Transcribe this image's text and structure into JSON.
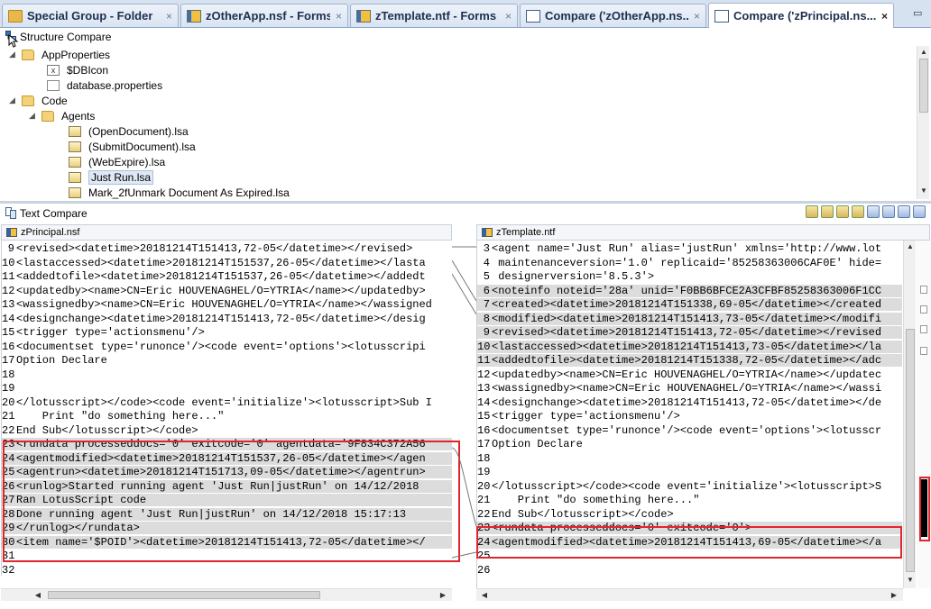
{
  "tabs": [
    {
      "label": "Special Group - Folder",
      "icon": "folder-icon",
      "active": false
    },
    {
      "label": "zOtherApp.nsf - Forms",
      "icon": "database-icon",
      "active": false
    },
    {
      "label": "zTemplate.ntf - Forms",
      "icon": "database-icon",
      "active": false
    },
    {
      "label": "Compare ('zOtherApp.ns...",
      "icon": "compare-icon",
      "active": false
    },
    {
      "label": "Compare ('zPrincipal.ns...",
      "icon": "compare-icon",
      "active": true
    }
  ],
  "close_glyph": "×",
  "structure_compare": {
    "title": "Structure Compare",
    "tree": [
      {
        "label": "AppProperties",
        "type": "folder",
        "expanded": true
      },
      {
        "label": "$DBIcon",
        "type": "resource"
      },
      {
        "label": "database.properties",
        "type": "document"
      },
      {
        "label": "Code",
        "type": "folder",
        "expanded": true
      },
      {
        "label": "Agents",
        "type": "folder",
        "expanded": true
      },
      {
        "label": "(OpenDocument).lsa",
        "type": "agent"
      },
      {
        "label": "(SubmitDocument).lsa",
        "type": "agent"
      },
      {
        "label": "(WebExpire).lsa",
        "type": "agent"
      },
      {
        "label": "Just Run.lsa",
        "type": "agent",
        "selected": true
      },
      {
        "label": "Mark_2fUnmark Document As Expired.lsa",
        "type": "agent"
      }
    ]
  },
  "text_compare": {
    "title": "Text Compare",
    "left": {
      "file": "zPrincipal.nsf",
      "lines": [
        {
          "n": "9",
          "t": "<revised><datetime>20181214T151413,72-05</datetime></revised>"
        },
        {
          "n": "10",
          "t": "<lastaccessed><datetime>20181214T151537,26-05</datetime></lasta"
        },
        {
          "n": "11",
          "t": "<addedtofile><datetime>20181214T151537,26-05</datetime></addedt"
        },
        {
          "n": "12",
          "t": "<updatedby><name>CN=Eric HOUVENAGHEL/O=YTRIA</name></updatedby>"
        },
        {
          "n": "13",
          "t": "<wassignedby><name>CN=Eric HOUVENAGHEL/O=YTRIA</name></wassigned"
        },
        {
          "n": "14",
          "t": "<designchange><datetime>20181214T151413,72-05</datetime></desig"
        },
        {
          "n": "15",
          "t": "<trigger type='actionsmenu'/>"
        },
        {
          "n": "16",
          "t": "<documentset type='runonce'/><code event='options'><lotusscripi"
        },
        {
          "n": "17",
          "t": "Option Declare"
        },
        {
          "n": "18",
          "t": ""
        },
        {
          "n": "19",
          "t": ""
        },
        {
          "n": "20",
          "t": "</lotusscript></code><code event='initialize'><lotusscript>Sub I"
        },
        {
          "n": "21",
          "t": "    Print \"do something here...\""
        },
        {
          "n": "22",
          "t": "End Sub</lotusscript></code>"
        },
        {
          "n": "23",
          "t": "<rundata processeddocs='0' exitcode='0' agentdata='9F834C372A56"
        },
        {
          "n": "24",
          "t": "<agentmodified><datetime>20181214T151537,26-05</datetime></agen"
        },
        {
          "n": "25",
          "t": "<agentrun><datetime>20181214T151713,09-05</datetime></agentrun>"
        },
        {
          "n": "26",
          "t": "<runlog>Started running agent 'Just Run|justRun' on 14/12/2018 "
        },
        {
          "n": "27",
          "t": "Ran LotusScript code"
        },
        {
          "n": "28",
          "t": "Done running agent 'Just Run|justRun' on 14/12/2018 15:17:13"
        },
        {
          "n": "29",
          "t": "</runlog></rundata>"
        },
        {
          "n": "30",
          "t": "<item name='$POID'><datetime>20181214T151413,72-05</datetime></"
        },
        {
          "n": "31",
          "t": ""
        },
        {
          "n": "32",
          "t": ""
        }
      ]
    },
    "right": {
      "file": "zTemplate.ntf",
      "lines": [
        {
          "n": "3",
          "t": "<agent name='Just Run' alias='justRun' xmlns='http://www.lot"
        },
        {
          "n": "4",
          "t": " maintenanceversion='1.0' replicaid='85258363006CAF0E' hide="
        },
        {
          "n": "5",
          "t": " designerversion='8.5.3'>"
        },
        {
          "n": "6",
          "t": "<noteinfo noteid='28a' unid='F0BB6BFCE2A3CFBF85258363006F1CC"
        },
        {
          "n": "7",
          "t": "<created><datetime>20181214T151338,69-05</datetime></created"
        },
        {
          "n": "8",
          "t": "<modified><datetime>20181214T151413,73-05</datetime></modifi"
        },
        {
          "n": "9",
          "t": "<revised><datetime>20181214T151413,72-05</datetime></revised"
        },
        {
          "n": "10",
          "t": "<lastaccessed><datetime>20181214T151413,73-05</datetime></la"
        },
        {
          "n": "11",
          "t": "<addedtofile><datetime>20181214T151338,72-05</datetime></adc"
        },
        {
          "n": "12",
          "t": "<updatedby><name>CN=Eric HOUVENAGHEL/O=YTRIA</name></updatec"
        },
        {
          "n": "13",
          "t": "<wassignedby><name>CN=Eric HOUVENAGHEL/O=YTRIA</name></wassi"
        },
        {
          "n": "14",
          "t": "<designchange><datetime>20181214T151413,72-05</datetime></de"
        },
        {
          "n": "15",
          "t": "<trigger type='actionsmenu'/>"
        },
        {
          "n": "16",
          "t": "<documentset type='runonce'/><code event='options'><lotusscr"
        },
        {
          "n": "17",
          "t": "Option Declare"
        },
        {
          "n": "18",
          "t": ""
        },
        {
          "n": "19",
          "t": ""
        },
        {
          "n": "20",
          "t": "</lotusscript></code><code event='initialize'><lotusscript>S"
        },
        {
          "n": "21",
          "t": "    Print \"do something here...\""
        },
        {
          "n": "22",
          "t": "End Sub</lotusscript></code>"
        },
        {
          "n": "23",
          "t": "<rundata processeddocs='0' exitcode='0'>"
        },
        {
          "n": "24",
          "t": "<agentmodified><datetime>20181214T151413,69-05</datetime></a"
        },
        {
          "n": "25",
          "t": ""
        },
        {
          "n": "26",
          "t": ""
        }
      ]
    }
  },
  "colors": {
    "highlight_box": "#e0262c",
    "diff_background": "#dcdcdc",
    "tab_bar": "#d7e2f0"
  }
}
